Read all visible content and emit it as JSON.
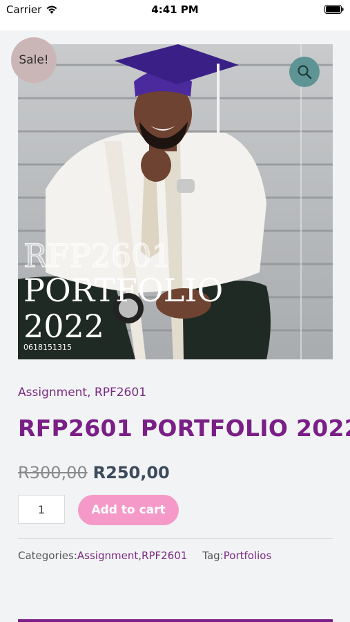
{
  "status_bar": {
    "carrier": "Carrier",
    "time": "4:41 PM"
  },
  "product": {
    "sale_badge": "Sale!",
    "image_overlay": {
      "line1": "RFP2601",
      "line2": "PORTFOLIO",
      "line3": "2022",
      "phone": "0618151315"
    },
    "categories_line": "Assignment, RPF2601",
    "title": "RFP2601 PORTFOLIO 2022",
    "old_price": "R300,00",
    "new_price": "R250,00",
    "quantity": "1",
    "add_to_cart_label": "Add to cart",
    "meta": {
      "categories_label": "Categories: ",
      "category_1": "Assignment",
      "separator": ", ",
      "category_2": "RPF2601",
      "tag_label": "Tag: ",
      "tag_1": "Portfolios"
    }
  },
  "colors": {
    "accent_purple": "#7a1f86",
    "button_pink": "#f59ac8",
    "zoom_teal": "#5e9594",
    "sale_badge": "#cbb6b7"
  },
  "icons": {
    "wifi": "wifi-icon",
    "battery": "battery-icon",
    "zoom": "search-icon"
  }
}
